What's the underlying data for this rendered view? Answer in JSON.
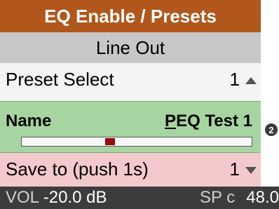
{
  "title": "EQ Enable / Presets",
  "subheader": "Line Out",
  "preset": {
    "label": "Preset Select",
    "value": "1"
  },
  "name": {
    "label": "Name",
    "value_first": "P",
    "value_rest": "EQ Test 1",
    "slider_position": 0.38
  },
  "badge": "2",
  "save": {
    "label": "Save to (push 1s)",
    "value": "1"
  },
  "status": {
    "vol_label": "VOL",
    "vol_value": "-20.0 dB",
    "sp_label": "SP c",
    "sp_value": "48.0"
  },
  "colors": {
    "title_bg": "#b1571c",
    "subheader_bg": "#c7c7c7",
    "name_bg": "#a7d5a1",
    "save_bg": "#f3c9cc",
    "status_bg": "#3c3c3c",
    "slider_thumb": "#9a0a0a"
  },
  "icons": {
    "up": "triangle-up-icon",
    "down": "triangle-down-icon",
    "badge": "number-2-badge-icon"
  }
}
